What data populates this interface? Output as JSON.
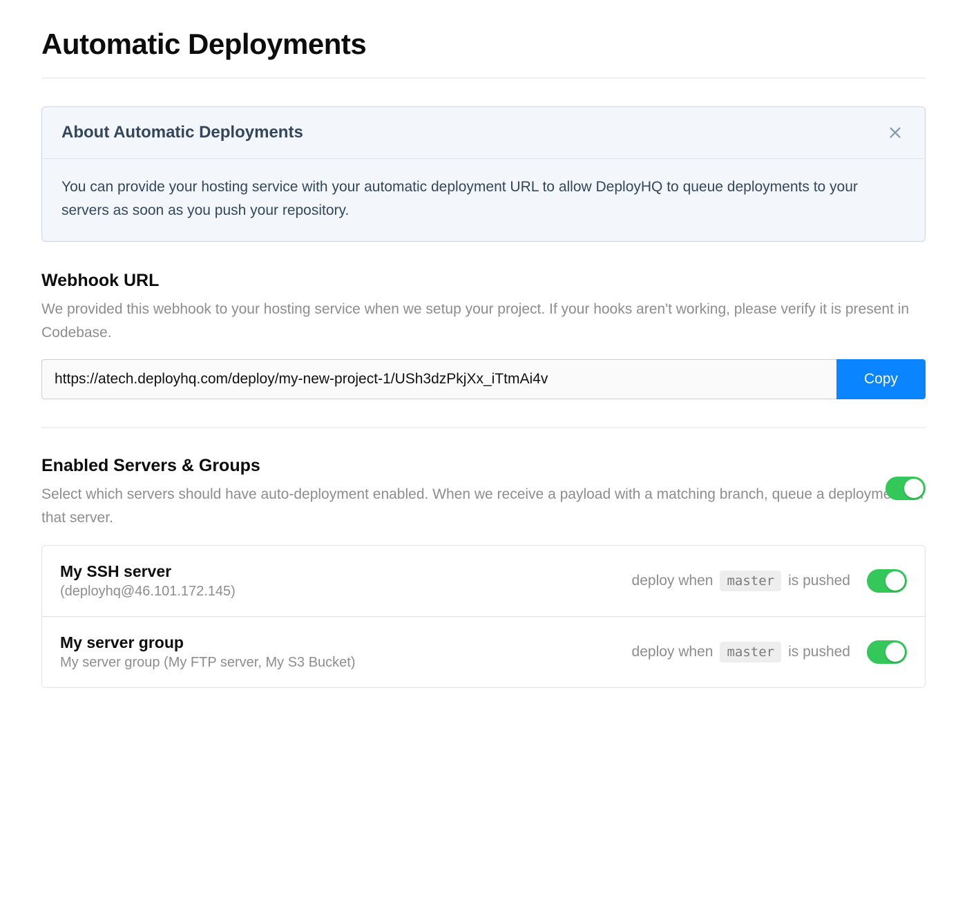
{
  "page": {
    "title": "Automatic Deployments"
  },
  "info": {
    "title": "About Automatic Deployments",
    "body": "You can provide your hosting service with your automatic deployment URL to allow DeployHQ to queue deployments to your servers as soon as you push your repository."
  },
  "webhook": {
    "heading": "Webhook URL",
    "description": "We provided this webhook to your hosting service when we setup your project. If your hooks aren't working, please verify it is present in Codebase.",
    "url": "https://atech.deployhq.com/deploy/my-new-project-1/USh3dzPkjXx_iTtmAi4v",
    "copy_label": "Copy"
  },
  "enabled": {
    "heading": "Enabled Servers & Groups",
    "description": "Select which servers should have auto-deployment enabled. When we receive a payload with a matching branch, queue a deployment on that server.",
    "global_on": true
  },
  "deploy_phrase": {
    "prefix": "deploy when",
    "suffix": "is pushed"
  },
  "servers": [
    {
      "name": "My SSH server",
      "sub": "(deployhq@46.101.172.145)",
      "branch": "master",
      "on": true
    },
    {
      "name": "My server group",
      "sub": "My server group (My FTP server, My S3 Bucket)",
      "branch": "master",
      "on": true
    }
  ]
}
